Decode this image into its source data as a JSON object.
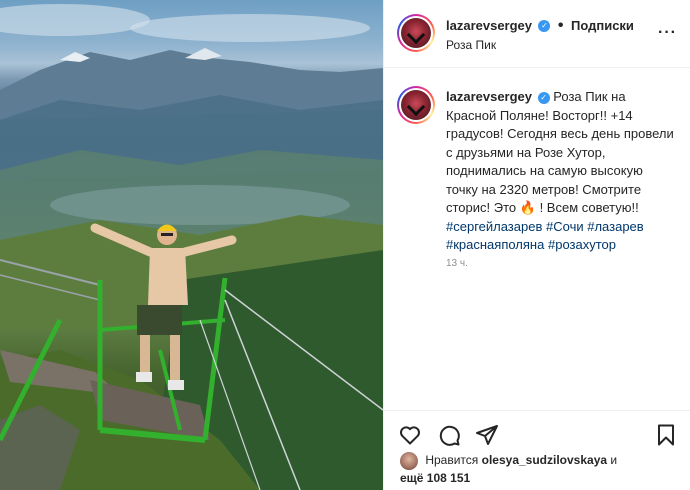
{
  "post": {
    "author": "lazarevsergey",
    "follow_label": "Подписки",
    "location": "Роза Пик",
    "caption_author": "lazarevsergey",
    "caption_line": "Роза Пик на Красной Поляне! Восторг!! +14 градусов! Сегодня весь день провели с друзьями на Розе Хутор, поднимались на самую высокую точку на 2320 метров! Смотрите сторис! Это",
    "caption_tail": "! Всем советую!!",
    "fire_emoji": "🔥",
    "hashtags": [
      "#сергейлазарев",
      "#Сочи",
      "#лазарев",
      "#краснаяполяна",
      "#розахутор"
    ],
    "time_ago": "13 ч."
  },
  "likes": {
    "prefix": "Нравится",
    "user": "olesya_sudzilovskaya",
    "middle": "и",
    "more": "ещё 108 151"
  },
  "icons": {
    "verified": "verified-badge-icon",
    "like": "heart-icon",
    "comment": "comment-icon",
    "share": "send-icon",
    "save": "bookmark-icon",
    "more": "more-options-icon"
  },
  "colors": {
    "link": "#00376b",
    "verified": "#3897f0",
    "muted": "#8e8e8e"
  }
}
